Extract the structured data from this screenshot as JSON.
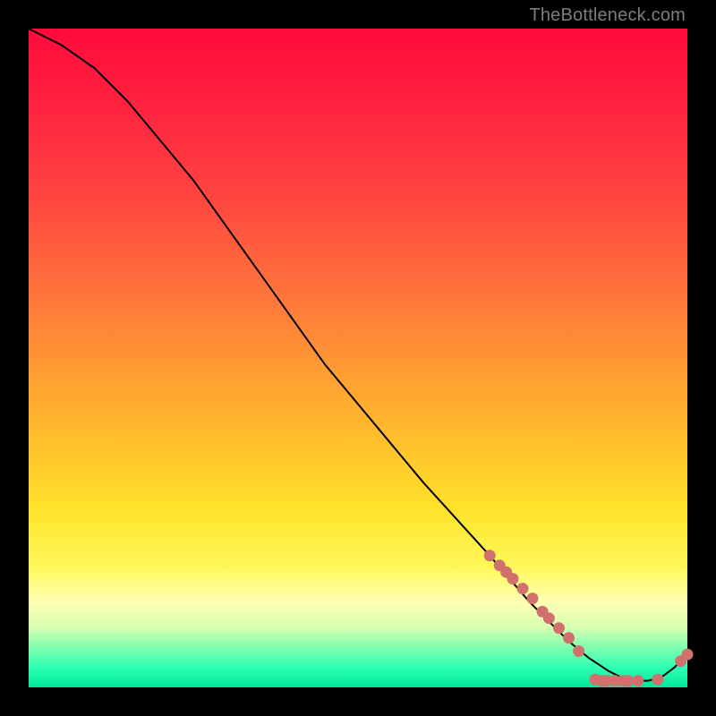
{
  "watermark": "TheBottleneck.com",
  "chart_data": {
    "type": "line",
    "title": "",
    "xlabel": "",
    "ylabel": "",
    "xlim": [
      0,
      100
    ],
    "ylim": [
      0,
      100
    ],
    "grid": false,
    "legend": false,
    "series": [
      {
        "name": "curve",
        "x": [
          0,
          5,
          10,
          15,
          20,
          25,
          30,
          35,
          40,
          45,
          50,
          55,
          60,
          65,
          70,
          73,
          76,
          79,
          82,
          85,
          88,
          90,
          92,
          94,
          96,
          98,
          100
        ],
        "y": [
          100,
          97.5,
          94,
          89,
          83,
          77,
          70,
          63,
          56,
          49,
          43,
          37,
          31,
          25.5,
          20,
          16.5,
          13,
          10,
          7,
          4.5,
          2.5,
          1.5,
          1,
          1,
          1.5,
          3,
          5
        ]
      }
    ],
    "markers": [
      {
        "x": 70,
        "y": 20
      },
      {
        "x": 71.5,
        "y": 18.5
      },
      {
        "x": 72.5,
        "y": 17.5
      },
      {
        "x": 73.5,
        "y": 16.5
      },
      {
        "x": 75,
        "y": 15
      },
      {
        "x": 76.5,
        "y": 13.5
      },
      {
        "x": 78,
        "y": 11.5
      },
      {
        "x": 79,
        "y": 10.5
      },
      {
        "x": 80.5,
        "y": 9
      },
      {
        "x": 82,
        "y": 7.5
      },
      {
        "x": 83.5,
        "y": 5.5
      },
      {
        "x": 86,
        "y": 1.2
      },
      {
        "x": 87,
        "y": 1
      },
      {
        "x": 87.8,
        "y": 1
      },
      {
        "x": 89,
        "y": 1
      },
      {
        "x": 90.2,
        "y": 1
      },
      {
        "x": 91,
        "y": 1
      },
      {
        "x": 92.5,
        "y": 1
      },
      {
        "x": 95.5,
        "y": 1.2
      },
      {
        "x": 99,
        "y": 4
      },
      {
        "x": 100,
        "y": 5
      }
    ],
    "colors": {
      "line": "#000000",
      "marker": "#d1716d"
    }
  }
}
